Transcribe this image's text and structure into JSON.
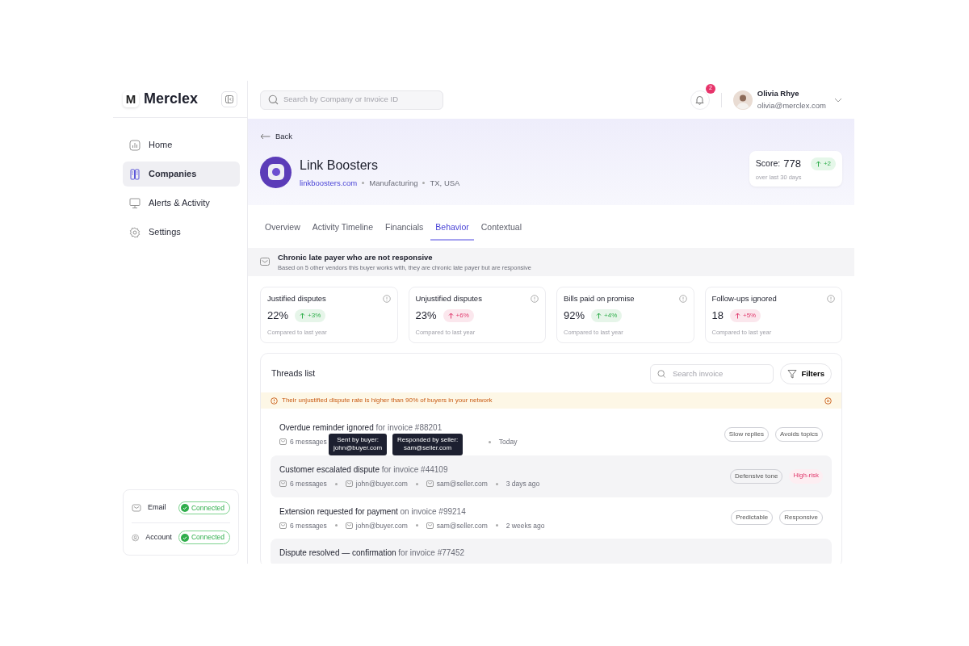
{
  "brand": {
    "logo": "M",
    "name": "Merclex"
  },
  "search": {
    "placeholder": "Search by Company or Invoice ID"
  },
  "notifications": {
    "count": "2"
  },
  "user": {
    "name": "Olivia Rhye",
    "email": "olivia@merclex.com"
  },
  "nav": [
    {
      "label": "Home",
      "selected": false
    },
    {
      "label": "Companies",
      "selected": true
    },
    {
      "label": "Alerts & Activity",
      "selected": false
    },
    {
      "label": "Settings",
      "selected": false
    }
  ],
  "integrations": [
    {
      "label": "Email",
      "status": "Connected",
      "connected": true
    },
    {
      "label": "Account",
      "status": "Connected",
      "connected": true
    }
  ],
  "back": "Back",
  "company": {
    "name": "Link Boosters",
    "website": "linkboosters.com",
    "industry": "Manufacturing",
    "location": "TX, USA"
  },
  "score": {
    "label": "Score:",
    "value": "778",
    "change": "+2",
    "period": "over last 30 days"
  },
  "tabs": [
    {
      "label": "Overview",
      "selected": false
    },
    {
      "label": "Activity Timeline",
      "selected": false
    },
    {
      "label": "Financials",
      "selected": false
    },
    {
      "label": "Behavior",
      "selected": true
    },
    {
      "label": "Contextual",
      "selected": false
    }
  ],
  "insight": {
    "title": "Chronic late payer who are not responsive",
    "text": "Based on 5 other vendors this buyer works with, they are chronic late payer but are responsive"
  },
  "metrics": [
    {
      "label": "Justified disputes",
      "value": "22%",
      "change": "+3%",
      "color": "#2fae4b",
      "note": "Compared to last year"
    },
    {
      "label": "Unjustified disputes",
      "value": "23%",
      "change": "+6%",
      "color": "#e0386c",
      "note": "Compared to last year"
    },
    {
      "label": "Bills paid on promise",
      "value": "92%",
      "change": "+4%",
      "color": "#2fae4b",
      "note": "Compared to last year"
    },
    {
      "label": "Follow-ups ignored",
      "value": "18",
      "change": "+5%",
      "color": "#e0386c",
      "note": "Compared to last year"
    }
  ],
  "threads": {
    "title": "Threads list",
    "search_placeholder": "Search invoice",
    "filter_label": "Filters",
    "alert": "Their unjustified dispute rate is higher than 90% of buyers in your network",
    "rows": [
      {
        "subject": "Overdue reminder ignored",
        "ref": "for invoice #88201",
        "messages": "6 messages",
        "time": "Today",
        "tooltips": [
          {
            "line1": "Sent by buyer:",
            "line2": "john@buyer.com"
          },
          {
            "line1": "Responded by seller:",
            "line2": "sam@seller.com"
          }
        ],
        "tags": [
          {
            "label": "Slow replies",
            "kind": "outline"
          },
          {
            "label": "Avoids topics",
            "kind": "outline"
          }
        ]
      },
      {
        "subject": "Customer escalated dispute",
        "ref": "for invoice #44109",
        "messages": "6 messages",
        "sender": "john@buyer.com",
        "receiver": "sam@seller.com",
        "time": "3 days ago",
        "tags": [
          {
            "label": "Defensive tone",
            "kind": "outline"
          },
          {
            "label": "High-risk",
            "kind": "risk"
          }
        ]
      },
      {
        "subject": "Extension requested for payment",
        "ref": "on invoice #99214",
        "messages": "6 messages",
        "sender": "john@buyer.com",
        "receiver": "sam@seller.com",
        "time": "2 weeks ago",
        "tags": [
          {
            "label": "Predictable",
            "kind": "outline"
          },
          {
            "label": "Responsive",
            "kind": "outline"
          }
        ]
      },
      {
        "subject": "Dispute resolved — confirmation",
        "ref": "for invoice #77452"
      }
    ]
  }
}
